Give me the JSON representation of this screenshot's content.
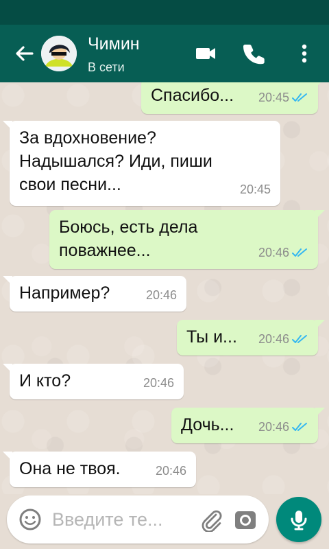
{
  "header": {
    "name": "Чимин",
    "status": "В сети"
  },
  "messages": [
    {
      "type": "outgoing",
      "text": "Спасибо...",
      "time": "20:45"
    },
    {
      "type": "incoming",
      "text": "За вдохновение?\nНадышался? Иди, пиши\nсвои песни...",
      "time": "20:45"
    },
    {
      "type": "outgoing",
      "text": "Боюсь, есть дела\nповажнее...",
      "time": "20:46"
    },
    {
      "type": "incoming",
      "text": "Например?",
      "time": "20:46"
    },
    {
      "type": "outgoing",
      "text": "Ты и...",
      "time": "20:46"
    },
    {
      "type": "incoming",
      "text": "И кто?",
      "time": "20:46"
    },
    {
      "type": "outgoing",
      "text": "Дочь...",
      "time": "20:46"
    },
    {
      "type": "incoming",
      "text": "Она не твоя.",
      "time": "20:46"
    }
  ],
  "composer": {
    "placeholder": "Введите те..."
  },
  "icons": {
    "back": "arrow-left-icon",
    "video": "video-camera-icon",
    "call": "phone-icon",
    "menu": "more-vertical-icon",
    "emoji": "emoji-icon",
    "attach": "paperclip-icon",
    "camera": "camera-icon",
    "mic": "microphone-icon",
    "read": "double-check-icon"
  },
  "colors": {
    "header": "#075e54",
    "status_bar": "#054c44",
    "outgoing_bubble": "#dcf8c6",
    "incoming_bubble": "#ffffff",
    "read_check": "#34b7f1",
    "mic_button": "#00897b"
  }
}
